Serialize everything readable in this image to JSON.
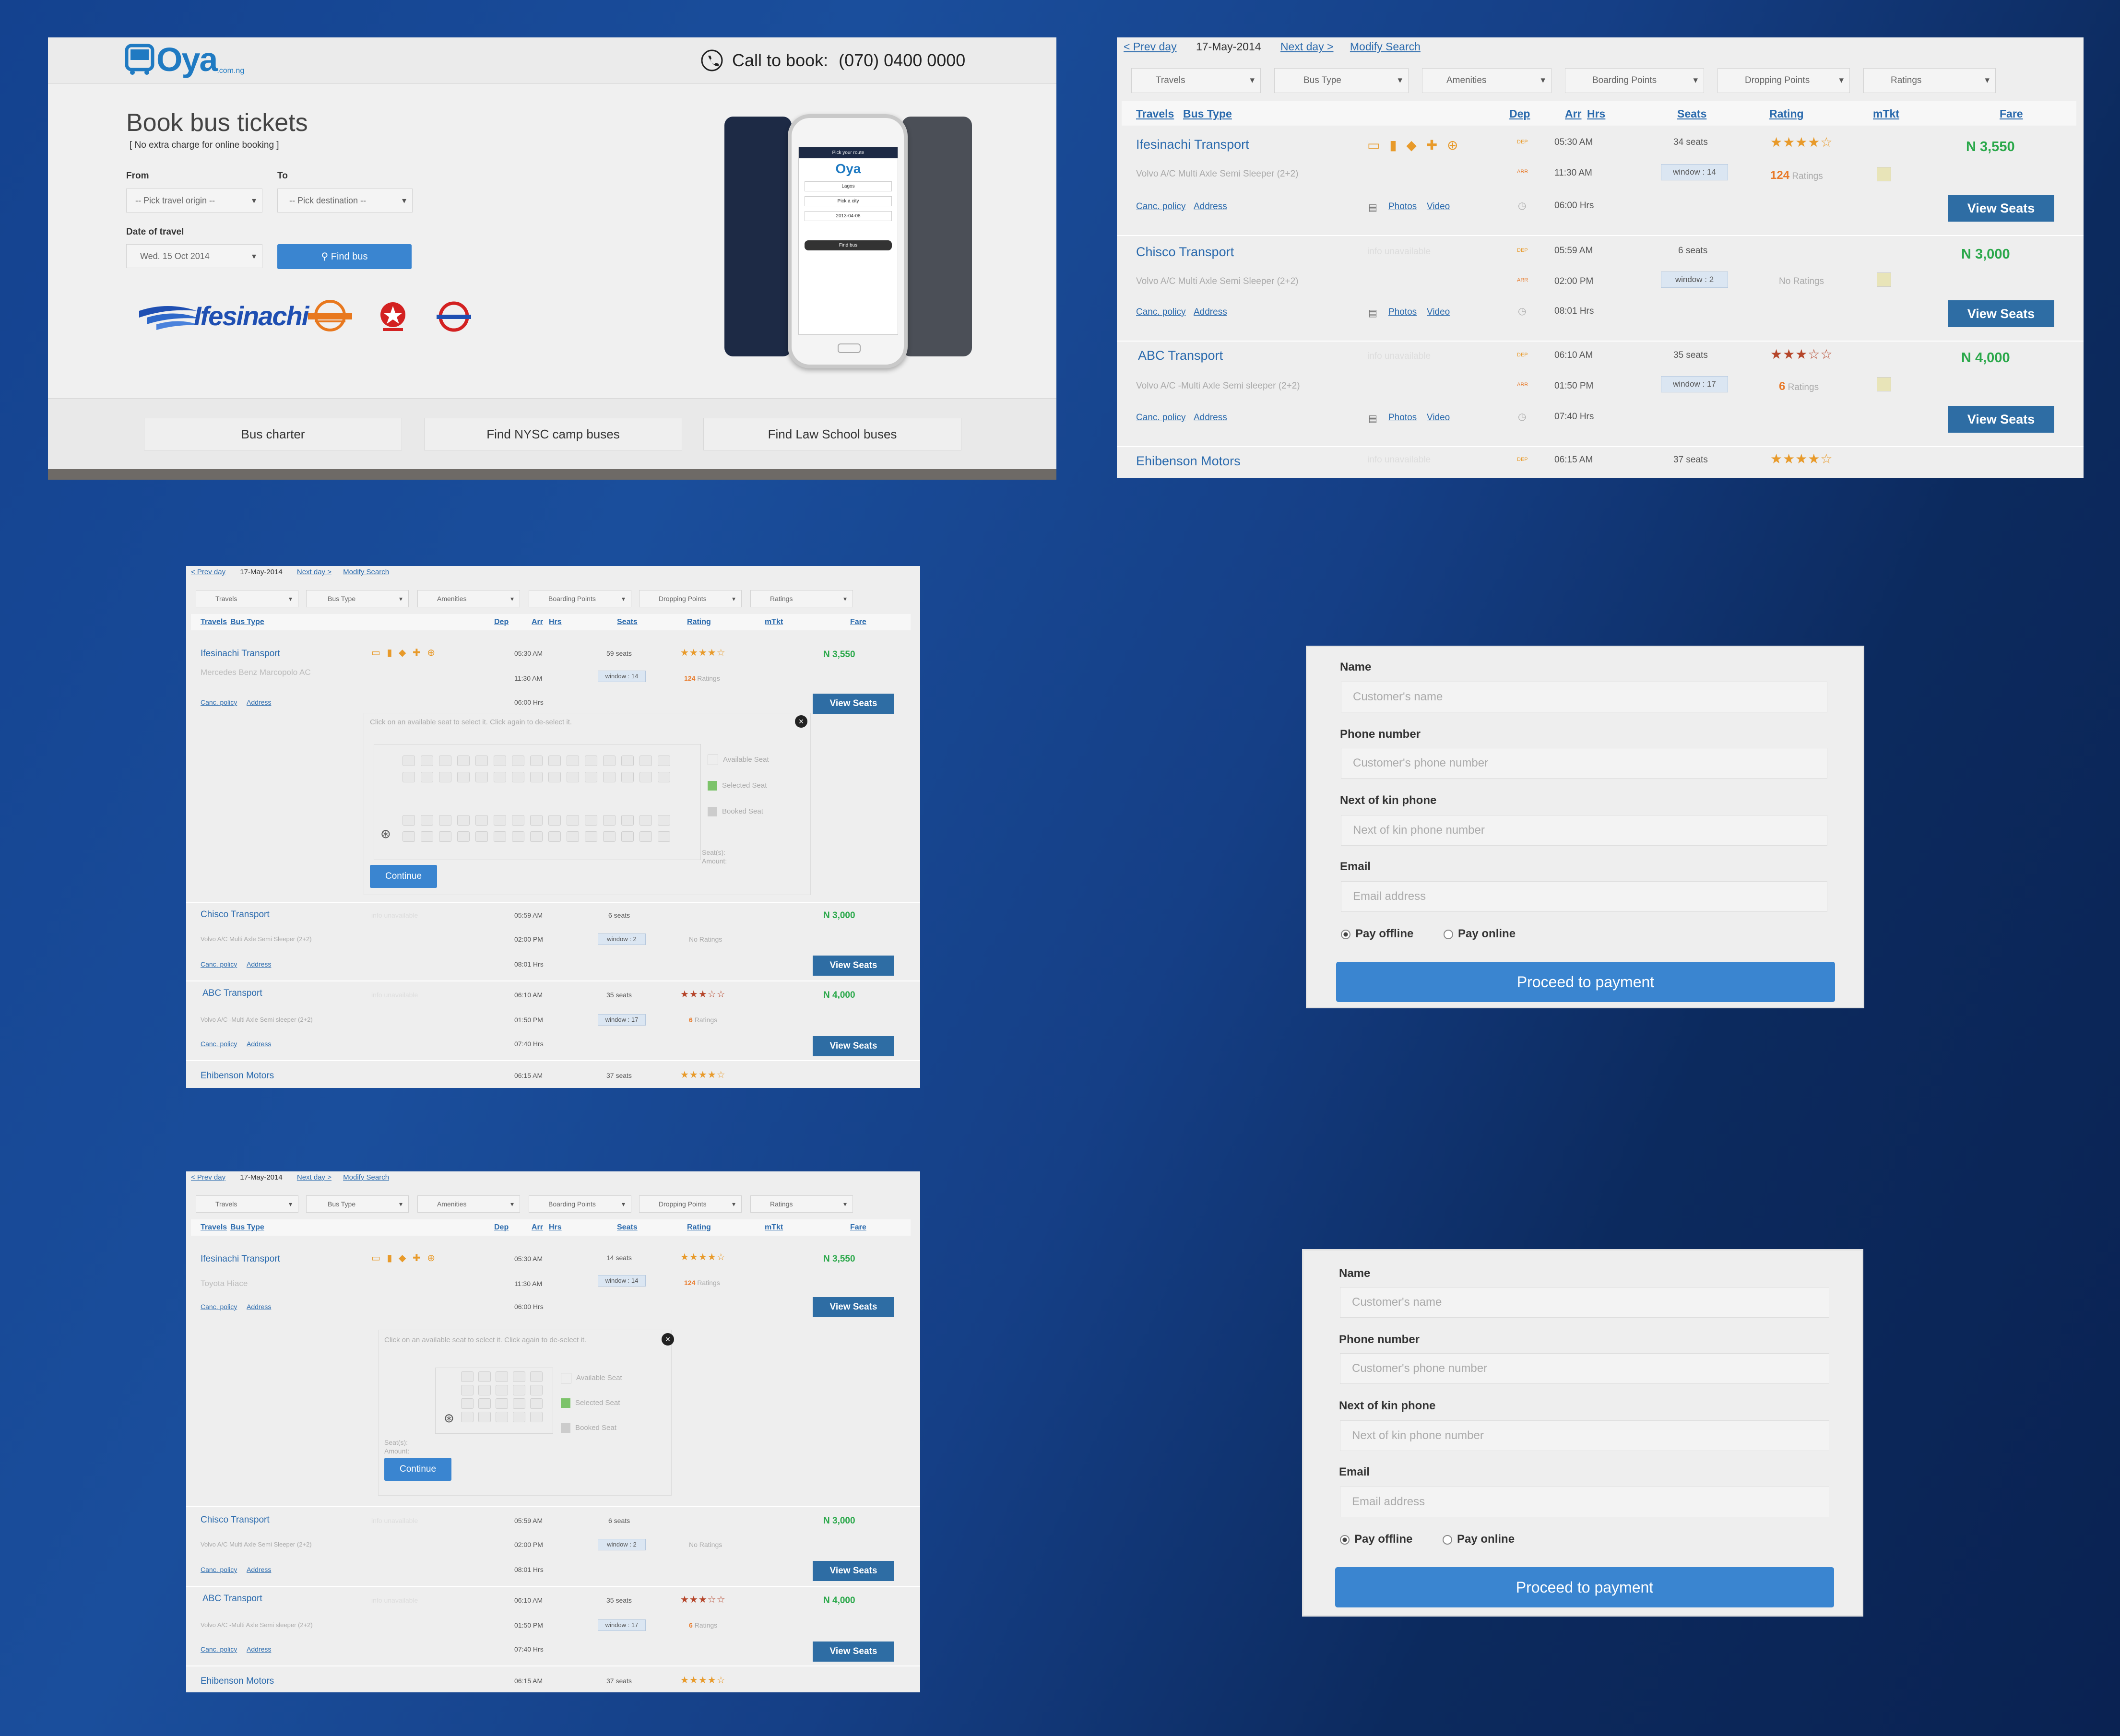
{
  "home": {
    "logo_text": "Oya",
    "logo_sub": ".com.ng",
    "call_label": "Call to book:",
    "phone": "(070) 0400 0000",
    "title": "Book bus tickets",
    "subtitle": "[ No extra charge for online booking ]",
    "from_label": "From",
    "to_label": "To",
    "from_placeholder": "-- Pick travel origin --",
    "to_placeholder": "-- Pick destination --",
    "date_label": "Date of travel",
    "date_value": "Wed. 15 Oct 2014",
    "find_button": "Find bus",
    "partner_logo": "Ifesinachi",
    "phone_mock": {
      "header": "Pick your route",
      "from": "Lagos",
      "to": "Pick a city",
      "date": "2013-04-08",
      "button": "Find bus"
    },
    "bottom_buttons": [
      "Bus charter",
      "Find NYSC camp buses",
      "Find Law School buses"
    ]
  },
  "results": {
    "prev": "< Prev day",
    "date": "17-May-2014",
    "next": "Next day >",
    "modify": "Modify Search",
    "filters": [
      "Travels",
      "Bus Type",
      "Amenities",
      "Boarding Points",
      "Dropping Points",
      "Ratings"
    ],
    "columns": {
      "travels": "Travels",
      "bus_type": "Bus Type",
      "dep": "Dep",
      "arr": "Arr",
      "hrs": "Hrs",
      "seats": "Seats",
      "rating": "Rating",
      "mtkt": "mTkt",
      "fare": "Fare"
    },
    "dep_tag": "DEP",
    "arr_tag": "ARR",
    "canc": "Canc. policy",
    "address": "Address",
    "photos": "Photos",
    "video": "Video",
    "view_seats": "View Seats",
    "info_na": "info unavailable",
    "operators": [
      {
        "name": "Ifesinachi Transport",
        "bus": "Volvo A/C Multi Axle Semi Sleeper (2+2)",
        "dep": "05:30 AM",
        "arr": "11:30 AM",
        "hrs": "06:00 Hrs",
        "seats": "34 seats",
        "window": "window : 14",
        "stars": "★★★★☆",
        "ratings_num": "124",
        "ratings_word": "Ratings",
        "fare": "N 3,550"
      },
      {
        "name": "Chisco Transport",
        "bus": "Volvo A/C Multi Axle Semi Sleeper (2+2)",
        "dep": "05:59 AM",
        "arr": "02:00 PM",
        "hrs": "08:01 Hrs",
        "seats": "6 seats",
        "window": "window : 2",
        "stars": "",
        "ratings_num": "",
        "ratings_word": "No Ratings",
        "fare": "N 3,000"
      },
      {
        "name": "ABC Transport",
        "bus": "Volvo A/C -Multi Axle Semi sleeper (2+2)",
        "dep": "06:10 AM",
        "arr": "01:50 PM",
        "hrs": "07:40 Hrs",
        "seats": "35 seats",
        "window": "window : 17",
        "stars": "★★★☆☆",
        "ratings_num": "6",
        "ratings_word": "Ratings",
        "fare": "N 4,000"
      },
      {
        "name": "Ehibenson Motors",
        "bus": "",
        "dep": "06:15 AM",
        "arr": "",
        "hrs": "",
        "seats": "37 seats",
        "window": "",
        "stars": "★★★★☆",
        "ratings_num": "",
        "ratings_word": "",
        "fare": ""
      }
    ]
  },
  "seatmap1": {
    "bus": "Mercedes Benz Marcopolo AC",
    "seats": "59 seats"
  },
  "seatmap2": {
    "bus": "Toyota Hiace",
    "seats": "14 seats"
  },
  "seatmap": {
    "instruction": "Click on an available seat to select it. Click again to de-select it.",
    "legend_available": "Available Seat",
    "legend_selected": "Selected Seat",
    "legend_booked": "Booked Seat",
    "seats_label": "Seat(s):",
    "amount_label": "Amount:",
    "continue": "Continue"
  },
  "form": {
    "name_label": "Name",
    "name_ph": "Customer's name",
    "phone_label": "Phone number",
    "phone_ph": "Customer's phone number",
    "kin_label": "Next of kin phone",
    "kin_ph": "Next of kin phone number",
    "email_label": "Email",
    "email_ph": "Email address",
    "pay_offline": "Pay offline",
    "pay_online": "Pay online",
    "proceed": "Proceed to payment"
  },
  "colors": {
    "brand_blue": "#2e6da4",
    "fare_green": "#2aa84a",
    "star_orange": "#e89a2a",
    "link_blue": "#2a6aad"
  }
}
